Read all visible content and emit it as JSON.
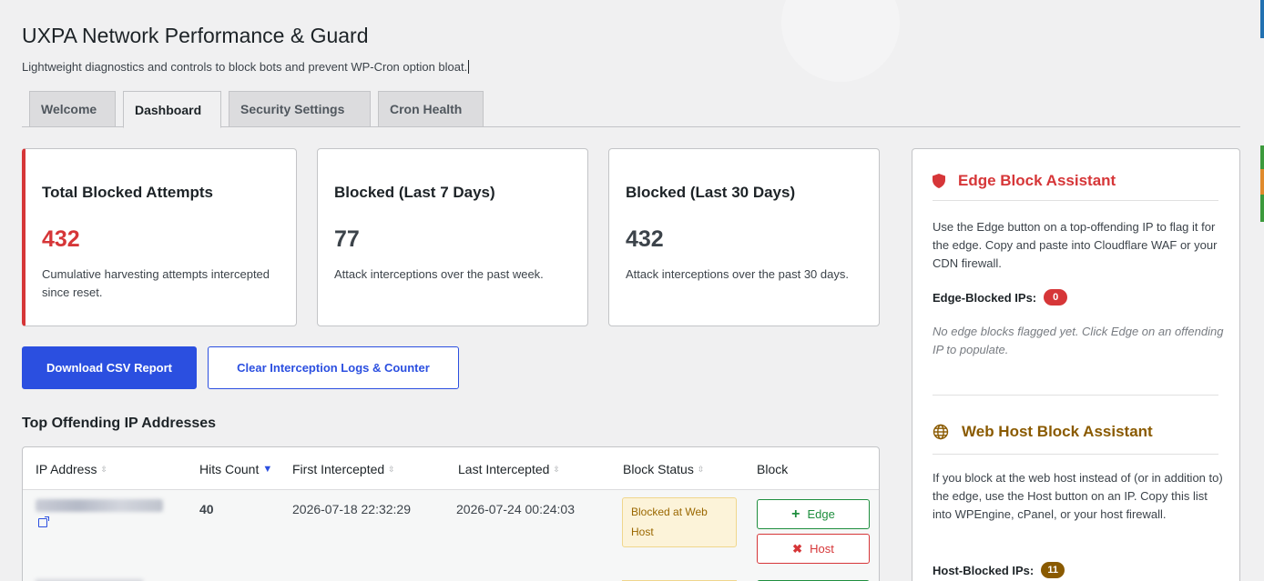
{
  "app": {
    "title": "UXPA Network Performance & Guard",
    "subtitle": "Lightweight diagnostics and controls to block bots and prevent WP-Cron option bloat."
  },
  "tabs": [
    {
      "label": "Welcome",
      "active": false
    },
    {
      "label": "Dashboard",
      "active": true
    },
    {
      "label": "Security Settings",
      "active": false
    },
    {
      "label": "Cron Health",
      "active": false
    }
  ],
  "stats": [
    {
      "title": "Total Blocked Attempts",
      "value": "432",
      "desc": "Cumulative harvesting attempts intercepted since reset."
    },
    {
      "title": "Blocked (Last 7 Days)",
      "value": "77",
      "desc": "Attack interceptions over the past week."
    },
    {
      "title": "Blocked (Last 30 Days)",
      "value": "432",
      "desc": "Attack interceptions over the past 30 days."
    }
  ],
  "actions": {
    "download_csv": "Download CSV Report",
    "clear_logs": "Clear Interception Logs & Counter"
  },
  "table": {
    "title": "Top Offending IP Addresses",
    "columns": [
      "IP Address",
      "Hits Count",
      "First Intercepted",
      "Last Intercepted",
      "Block Status",
      "Block"
    ],
    "sorted_column": "Hits Count",
    "rows": [
      {
        "hits": "40",
        "first": "2026-07-18 22:32:29",
        "last": "2026-07-24 00:24:03",
        "status": "Blocked at Web Host",
        "edge_label": "Edge",
        "host_label": "Host"
      }
    ]
  },
  "edge_assistant": {
    "title": "Edge Block Assistant",
    "desc": "Use the Edge button on a top-offending IP to flag it for the edge. Copy and paste into Cloudflare WAF or your CDN firewall.",
    "count_label": "Edge-Blocked IPs:",
    "count": "0",
    "empty": "No edge blocks flagged yet. Click Edge on an offending IP to populate."
  },
  "host_assistant": {
    "title": "Web Host Block Assistant",
    "desc": "If you block at the web host instead of (or in addition to) the edge, use the Host button on an IP. Copy this list into WPEngine, cPanel, or your host firewall.",
    "count_label": "Host-Blocked IPs:",
    "count": "11"
  },
  "colors": {
    "accent_blue": "#2b4fe0",
    "danger_red": "#d63638",
    "success_green": "#1e8e3e",
    "host_amber": "#8a5a00"
  }
}
